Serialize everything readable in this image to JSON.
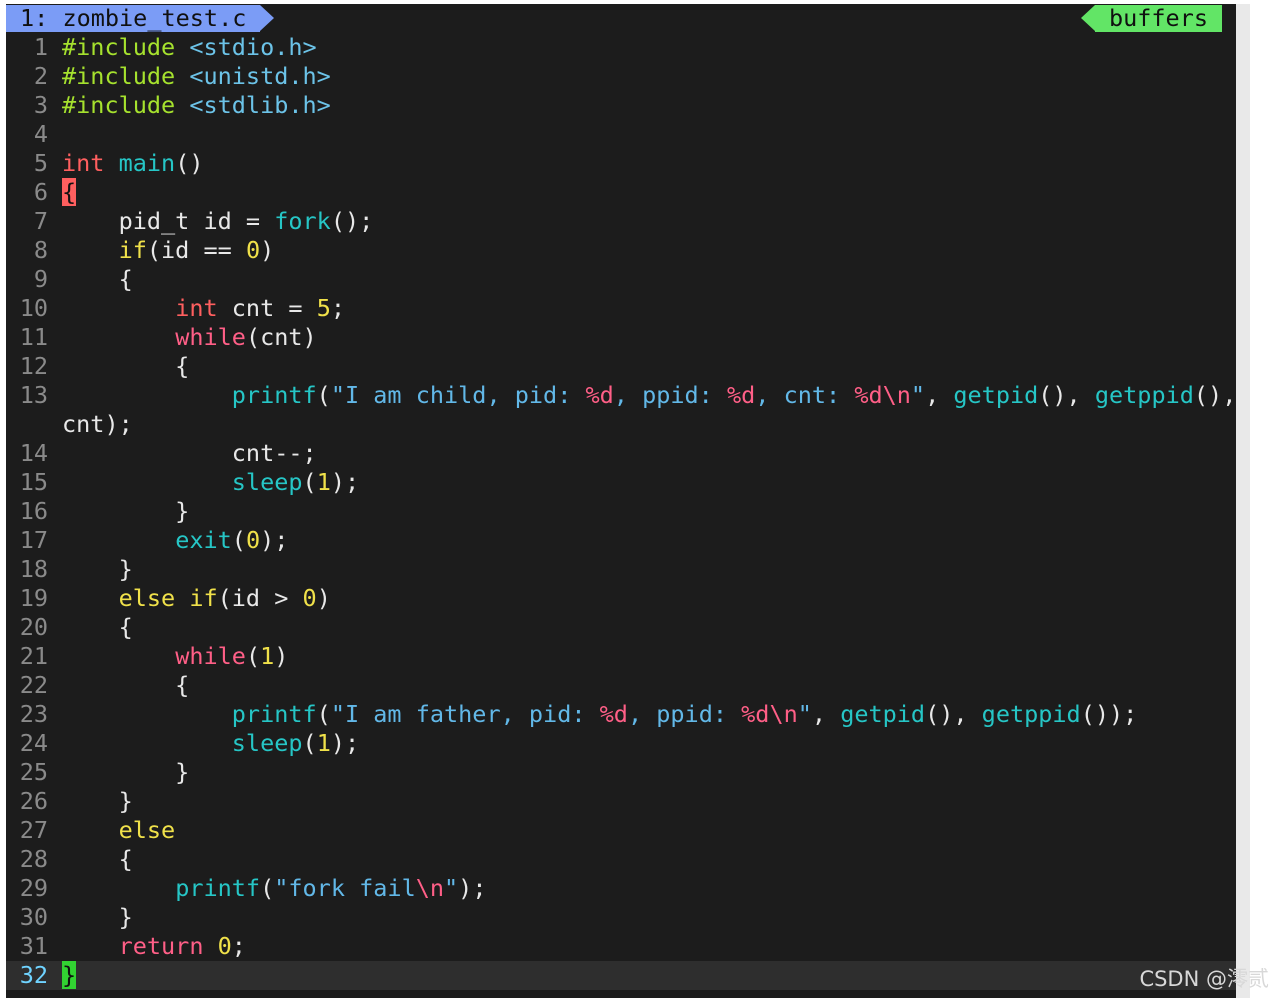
{
  "tabline": {
    "active_tab": "1: zombie_test.c",
    "buffers_label": "buffers",
    "active_tab_color": "#7b9cf6",
    "buffers_color": "#62e566"
  },
  "editor": {
    "lines": [
      {
        "n": "1",
        "tokens": [
          {
            "t": "#include",
            "c": "pre"
          },
          {
            "t": " ",
            "c": "id"
          },
          {
            "t": "<stdio.h>",
            "c": "inc"
          }
        ]
      },
      {
        "n": "2",
        "tokens": [
          {
            "t": "#include",
            "c": "pre"
          },
          {
            "t": " ",
            "c": "id"
          },
          {
            "t": "<unistd.h>",
            "c": "inc"
          }
        ]
      },
      {
        "n": "3",
        "tokens": [
          {
            "t": "#include",
            "c": "pre"
          },
          {
            "t": " ",
            "c": "id"
          },
          {
            "t": "<stdlib.h>",
            "c": "inc"
          }
        ]
      },
      {
        "n": "4",
        "tokens": []
      },
      {
        "n": "5",
        "tokens": [
          {
            "t": "int",
            "c": "kw"
          },
          {
            "t": " ",
            "c": "id"
          },
          {
            "t": "main",
            "c": "fn"
          },
          {
            "t": "()",
            "c": "id"
          }
        ]
      },
      {
        "n": "6",
        "tokens": [
          {
            "t": "{",
            "c": "brace-open"
          }
        ]
      },
      {
        "n": "7",
        "tokens": [
          {
            "t": "    pid_t id = ",
            "c": "id"
          },
          {
            "t": "fork",
            "c": "fn"
          },
          {
            "t": "();",
            "c": "id"
          }
        ]
      },
      {
        "n": "8",
        "tokens": [
          {
            "t": "    ",
            "c": "id"
          },
          {
            "t": "if",
            "c": "ctl"
          },
          {
            "t": "(id == ",
            "c": "id"
          },
          {
            "t": "0",
            "c": "num"
          },
          {
            "t": ")",
            "c": "id"
          }
        ]
      },
      {
        "n": "9",
        "tokens": [
          {
            "t": "    {",
            "c": "id"
          }
        ]
      },
      {
        "n": "10",
        "tokens": [
          {
            "t": "        ",
            "c": "id"
          },
          {
            "t": "int",
            "c": "kw"
          },
          {
            "t": " cnt = ",
            "c": "id"
          },
          {
            "t": "5",
            "c": "num"
          },
          {
            "t": ";",
            "c": "id"
          }
        ]
      },
      {
        "n": "11",
        "tokens": [
          {
            "t": "        ",
            "c": "id"
          },
          {
            "t": "while",
            "c": "rep"
          },
          {
            "t": "(cnt)",
            "c": "id"
          }
        ]
      },
      {
        "n": "12",
        "tokens": [
          {
            "t": "        {",
            "c": "id"
          }
        ]
      },
      {
        "n": "13",
        "tokens": [
          {
            "t": "            ",
            "c": "id"
          },
          {
            "t": "printf",
            "c": "fn"
          },
          {
            "t": "(",
            "c": "id"
          },
          {
            "t": "\"I am child, pid: ",
            "c": "str"
          },
          {
            "t": "%d",
            "c": "fmt"
          },
          {
            "t": ", ppid: ",
            "c": "str"
          },
          {
            "t": "%d",
            "c": "fmt"
          },
          {
            "t": ", cnt: ",
            "c": "str"
          },
          {
            "t": "%d",
            "c": "fmt"
          },
          {
            "t": "\\n",
            "c": "fmt"
          },
          {
            "t": "\"",
            "c": "str"
          },
          {
            "t": ", ",
            "c": "id"
          },
          {
            "t": "getpid",
            "c": "fn"
          },
          {
            "t": "(), ",
            "c": "id"
          },
          {
            "t": "getppid",
            "c": "fn"
          },
          {
            "t": "(),",
            "c": "id"
          }
        ],
        "cont": [
          {
            "t": "cnt);",
            "c": "id"
          }
        ]
      },
      {
        "n": "14",
        "tokens": [
          {
            "t": "            cnt--;",
            "c": "id"
          }
        ]
      },
      {
        "n": "15",
        "tokens": [
          {
            "t": "            ",
            "c": "id"
          },
          {
            "t": "sleep",
            "c": "fn"
          },
          {
            "t": "(",
            "c": "id"
          },
          {
            "t": "1",
            "c": "num"
          },
          {
            "t": ");",
            "c": "id"
          }
        ]
      },
      {
        "n": "16",
        "tokens": [
          {
            "t": "        }",
            "c": "id"
          }
        ]
      },
      {
        "n": "17",
        "tokens": [
          {
            "t": "        ",
            "c": "id"
          },
          {
            "t": "exit",
            "c": "fn"
          },
          {
            "t": "(",
            "c": "id"
          },
          {
            "t": "0",
            "c": "num"
          },
          {
            "t": ");",
            "c": "id"
          }
        ]
      },
      {
        "n": "18",
        "tokens": [
          {
            "t": "    }",
            "c": "id"
          }
        ]
      },
      {
        "n": "19",
        "tokens": [
          {
            "t": "    ",
            "c": "id"
          },
          {
            "t": "else",
            "c": "ctl"
          },
          {
            "t": " ",
            "c": "id"
          },
          {
            "t": "if",
            "c": "ctl"
          },
          {
            "t": "(id > ",
            "c": "id"
          },
          {
            "t": "0",
            "c": "num"
          },
          {
            "t": ")",
            "c": "id"
          }
        ]
      },
      {
        "n": "20",
        "tokens": [
          {
            "t": "    {",
            "c": "id"
          }
        ]
      },
      {
        "n": "21",
        "tokens": [
          {
            "t": "        ",
            "c": "id"
          },
          {
            "t": "while",
            "c": "rep"
          },
          {
            "t": "(",
            "c": "id"
          },
          {
            "t": "1",
            "c": "num"
          },
          {
            "t": ")",
            "c": "id"
          }
        ]
      },
      {
        "n": "22",
        "tokens": [
          {
            "t": "        {",
            "c": "id"
          }
        ]
      },
      {
        "n": "23",
        "tokens": [
          {
            "t": "            ",
            "c": "id"
          },
          {
            "t": "printf",
            "c": "fn"
          },
          {
            "t": "(",
            "c": "id"
          },
          {
            "t": "\"I am father, pid: ",
            "c": "str"
          },
          {
            "t": "%d",
            "c": "fmt"
          },
          {
            "t": ", ppid: ",
            "c": "str"
          },
          {
            "t": "%d",
            "c": "fmt"
          },
          {
            "t": "\\n",
            "c": "fmt"
          },
          {
            "t": "\"",
            "c": "str"
          },
          {
            "t": ", ",
            "c": "id"
          },
          {
            "t": "getpid",
            "c": "fn"
          },
          {
            "t": "(), ",
            "c": "id"
          },
          {
            "t": "getppid",
            "c": "fn"
          },
          {
            "t": "());",
            "c": "id"
          }
        ]
      },
      {
        "n": "24",
        "tokens": [
          {
            "t": "            ",
            "c": "id"
          },
          {
            "t": "sleep",
            "c": "fn"
          },
          {
            "t": "(",
            "c": "id"
          },
          {
            "t": "1",
            "c": "num"
          },
          {
            "t": ");",
            "c": "id"
          }
        ]
      },
      {
        "n": "25",
        "tokens": [
          {
            "t": "        }",
            "c": "id"
          }
        ]
      },
      {
        "n": "26",
        "tokens": [
          {
            "t": "    }",
            "c": "id"
          }
        ]
      },
      {
        "n": "27",
        "tokens": [
          {
            "t": "    ",
            "c": "id"
          },
          {
            "t": "else",
            "c": "ctl"
          }
        ]
      },
      {
        "n": "28",
        "tokens": [
          {
            "t": "    {",
            "c": "id"
          }
        ]
      },
      {
        "n": "29",
        "tokens": [
          {
            "t": "        ",
            "c": "id"
          },
          {
            "t": "printf",
            "c": "fn"
          },
          {
            "t": "(",
            "c": "id"
          },
          {
            "t": "\"fork fail",
            "c": "str"
          },
          {
            "t": "\\n",
            "c": "fmt"
          },
          {
            "t": "\"",
            "c": "str"
          },
          {
            "t": ");",
            "c": "id"
          }
        ]
      },
      {
        "n": "30",
        "tokens": [
          {
            "t": "    }",
            "c": "id"
          }
        ]
      },
      {
        "n": "31",
        "tokens": [
          {
            "t": "    ",
            "c": "id"
          },
          {
            "t": "return",
            "c": "rep"
          },
          {
            "t": " ",
            "c": "id"
          },
          {
            "t": "0",
            "c": "num"
          },
          {
            "t": ";",
            "c": "id"
          }
        ]
      },
      {
        "n": "32",
        "current": true,
        "tokens": [
          {
            "t": "}",
            "c": "brace-close"
          }
        ]
      }
    ]
  },
  "watermark": "CSDN @澪贰",
  "colors": {
    "background": "#1c1c1c",
    "preproc": "#a6e22e",
    "include": "#6cc3e8",
    "type_keyword": "#ff5f5f",
    "conditional": "#f0e14a",
    "repeat_return": "#ff5f87",
    "function": "#26c6c6",
    "string": "#62b8e8",
    "number": "#f0e14a",
    "line_number": "#8a8a8a",
    "current_line_number": "#6fd3ff"
  }
}
